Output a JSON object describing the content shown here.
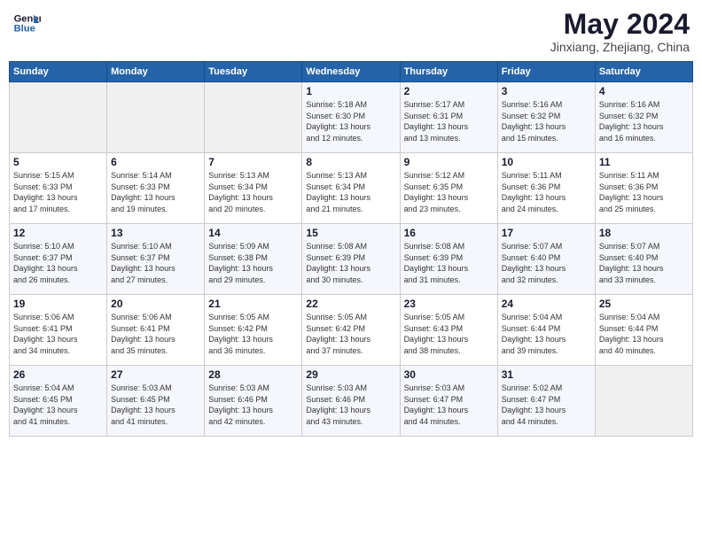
{
  "header": {
    "logo_line1": "General",
    "logo_line2": "Blue",
    "month_year": "May 2024",
    "location": "Jinxiang, Zhejiang, China"
  },
  "weekdays": [
    "Sunday",
    "Monday",
    "Tuesday",
    "Wednesday",
    "Thursday",
    "Friday",
    "Saturday"
  ],
  "weeks": [
    [
      {
        "day": "",
        "detail": ""
      },
      {
        "day": "",
        "detail": ""
      },
      {
        "day": "",
        "detail": ""
      },
      {
        "day": "1",
        "detail": "Sunrise: 5:18 AM\nSunset: 6:30 PM\nDaylight: 13 hours\nand 12 minutes."
      },
      {
        "day": "2",
        "detail": "Sunrise: 5:17 AM\nSunset: 6:31 PM\nDaylight: 13 hours\nand 13 minutes."
      },
      {
        "day": "3",
        "detail": "Sunrise: 5:16 AM\nSunset: 6:32 PM\nDaylight: 13 hours\nand 15 minutes."
      },
      {
        "day": "4",
        "detail": "Sunrise: 5:16 AM\nSunset: 6:32 PM\nDaylight: 13 hours\nand 16 minutes."
      }
    ],
    [
      {
        "day": "5",
        "detail": "Sunrise: 5:15 AM\nSunset: 6:33 PM\nDaylight: 13 hours\nand 17 minutes."
      },
      {
        "day": "6",
        "detail": "Sunrise: 5:14 AM\nSunset: 6:33 PM\nDaylight: 13 hours\nand 19 minutes."
      },
      {
        "day": "7",
        "detail": "Sunrise: 5:13 AM\nSunset: 6:34 PM\nDaylight: 13 hours\nand 20 minutes."
      },
      {
        "day": "8",
        "detail": "Sunrise: 5:13 AM\nSunset: 6:34 PM\nDaylight: 13 hours\nand 21 minutes."
      },
      {
        "day": "9",
        "detail": "Sunrise: 5:12 AM\nSunset: 6:35 PM\nDaylight: 13 hours\nand 23 minutes."
      },
      {
        "day": "10",
        "detail": "Sunrise: 5:11 AM\nSunset: 6:36 PM\nDaylight: 13 hours\nand 24 minutes."
      },
      {
        "day": "11",
        "detail": "Sunrise: 5:11 AM\nSunset: 6:36 PM\nDaylight: 13 hours\nand 25 minutes."
      }
    ],
    [
      {
        "day": "12",
        "detail": "Sunrise: 5:10 AM\nSunset: 6:37 PM\nDaylight: 13 hours\nand 26 minutes."
      },
      {
        "day": "13",
        "detail": "Sunrise: 5:10 AM\nSunset: 6:37 PM\nDaylight: 13 hours\nand 27 minutes."
      },
      {
        "day": "14",
        "detail": "Sunrise: 5:09 AM\nSunset: 6:38 PM\nDaylight: 13 hours\nand 29 minutes."
      },
      {
        "day": "15",
        "detail": "Sunrise: 5:08 AM\nSunset: 6:39 PM\nDaylight: 13 hours\nand 30 minutes."
      },
      {
        "day": "16",
        "detail": "Sunrise: 5:08 AM\nSunset: 6:39 PM\nDaylight: 13 hours\nand 31 minutes."
      },
      {
        "day": "17",
        "detail": "Sunrise: 5:07 AM\nSunset: 6:40 PM\nDaylight: 13 hours\nand 32 minutes."
      },
      {
        "day": "18",
        "detail": "Sunrise: 5:07 AM\nSunset: 6:40 PM\nDaylight: 13 hours\nand 33 minutes."
      }
    ],
    [
      {
        "day": "19",
        "detail": "Sunrise: 5:06 AM\nSunset: 6:41 PM\nDaylight: 13 hours\nand 34 minutes."
      },
      {
        "day": "20",
        "detail": "Sunrise: 5:06 AM\nSunset: 6:41 PM\nDaylight: 13 hours\nand 35 minutes."
      },
      {
        "day": "21",
        "detail": "Sunrise: 5:05 AM\nSunset: 6:42 PM\nDaylight: 13 hours\nand 36 minutes."
      },
      {
        "day": "22",
        "detail": "Sunrise: 5:05 AM\nSunset: 6:42 PM\nDaylight: 13 hours\nand 37 minutes."
      },
      {
        "day": "23",
        "detail": "Sunrise: 5:05 AM\nSunset: 6:43 PM\nDaylight: 13 hours\nand 38 minutes."
      },
      {
        "day": "24",
        "detail": "Sunrise: 5:04 AM\nSunset: 6:44 PM\nDaylight: 13 hours\nand 39 minutes."
      },
      {
        "day": "25",
        "detail": "Sunrise: 5:04 AM\nSunset: 6:44 PM\nDaylight: 13 hours\nand 40 minutes."
      }
    ],
    [
      {
        "day": "26",
        "detail": "Sunrise: 5:04 AM\nSunset: 6:45 PM\nDaylight: 13 hours\nand 41 minutes."
      },
      {
        "day": "27",
        "detail": "Sunrise: 5:03 AM\nSunset: 6:45 PM\nDaylight: 13 hours\nand 41 minutes."
      },
      {
        "day": "28",
        "detail": "Sunrise: 5:03 AM\nSunset: 6:46 PM\nDaylight: 13 hours\nand 42 minutes."
      },
      {
        "day": "29",
        "detail": "Sunrise: 5:03 AM\nSunset: 6:46 PM\nDaylight: 13 hours\nand 43 minutes."
      },
      {
        "day": "30",
        "detail": "Sunrise: 5:03 AM\nSunset: 6:47 PM\nDaylight: 13 hours\nand 44 minutes."
      },
      {
        "day": "31",
        "detail": "Sunrise: 5:02 AM\nSunset: 6:47 PM\nDaylight: 13 hours\nand 44 minutes."
      },
      {
        "day": "",
        "detail": ""
      }
    ]
  ]
}
